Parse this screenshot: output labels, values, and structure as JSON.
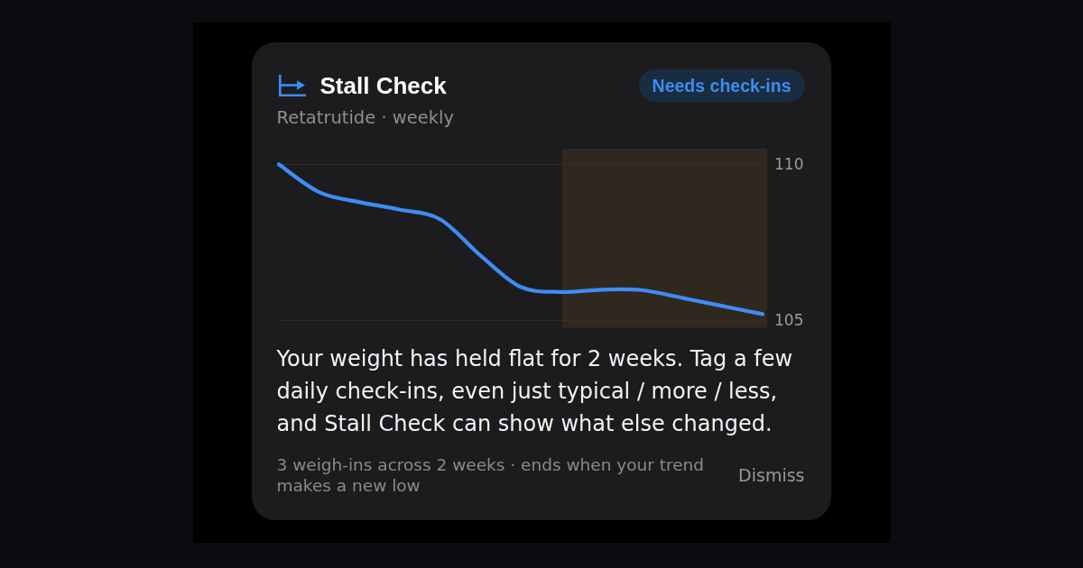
{
  "card": {
    "title": "Stall Check",
    "badge": "Needs check-ins",
    "subtitle": "Retatrutide · weekly",
    "chart_data": {
      "type": "line",
      "categories": [
        null,
        null,
        null,
        null,
        null,
        null,
        null,
        null,
        null,
        null,
        null,
        null,
        null
      ],
      "series": [
        {
          "color": "#3d8df5",
          "values": [
            110.0,
            109.11,
            108.79,
            108.55,
            108.24,
            107.08,
            106.07,
            105.91,
            105.98,
            105.97,
            105.72,
            105.46,
            105.2
          ]
        }
      ],
      "ylim": [
        105,
        110
      ],
      "yticks": [
        {
          "value": 105,
          "label": "105"
        },
        {
          "value": 110,
          "label": "110"
        }
      ]
    },
    "message": "Your weight has held flat for 2 weeks. Tag a few daily check-ins, even just typical / more / less, and Stall Check can show what else changed.",
    "footnote": "3 weigh-ins across 2 weeks · ends when your trend makes a new low",
    "dismiss": "Dismiss"
  }
}
